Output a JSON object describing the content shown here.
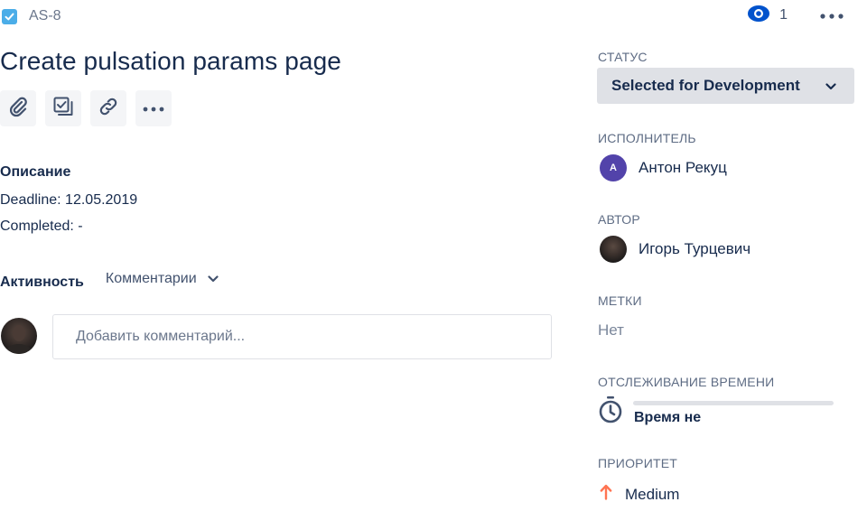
{
  "header": {
    "issue_key": "AS-8",
    "issue_type_icon": "checkbox-task-icon",
    "watchers_count": "1"
  },
  "issue": {
    "title": "Create pulsation params page"
  },
  "toolbar": {
    "buttons": [
      {
        "icon": "paperclip-icon",
        "name": "attach"
      },
      {
        "icon": "subtask-icon",
        "name": "subtask"
      },
      {
        "icon": "link-icon",
        "name": "link"
      },
      {
        "icon": "more-icon",
        "name": "more"
      }
    ]
  },
  "description": {
    "heading": "Описание",
    "lines": [
      "Deadline: 12.05.2019",
      "Completed: -"
    ]
  },
  "activity": {
    "heading": "Активность",
    "filter_label": "Комментарии",
    "comment_placeholder": "Добавить комментарий..."
  },
  "sidebar": {
    "status": {
      "label": "СТАТУС",
      "value": "Selected for Development"
    },
    "assignee": {
      "label": "ИСПОЛНИТЕЛЬ",
      "name": "Антон Рекуц",
      "avatar_letter": "A"
    },
    "reporter": {
      "label": "АВТОР",
      "name": "Игорь Турцевич"
    },
    "labels": {
      "label": "МЕТКИ",
      "value": "Нет"
    },
    "time_tracking": {
      "label": "ОТСЛЕЖИВАНИЕ ВРЕМЕНИ",
      "text": "Время не",
      "progress": 0
    },
    "priority": {
      "label": "ПРИОРИТЕТ",
      "value": "Medium",
      "icon": "arrow-up-icon"
    }
  },
  "colors": {
    "issue_type": "#4bade8",
    "watch_icon": "#0052cc",
    "assignee_avatar": "#5243aa",
    "priority_arrow": "#ff7452",
    "status_bg": "#dfe1e6"
  }
}
